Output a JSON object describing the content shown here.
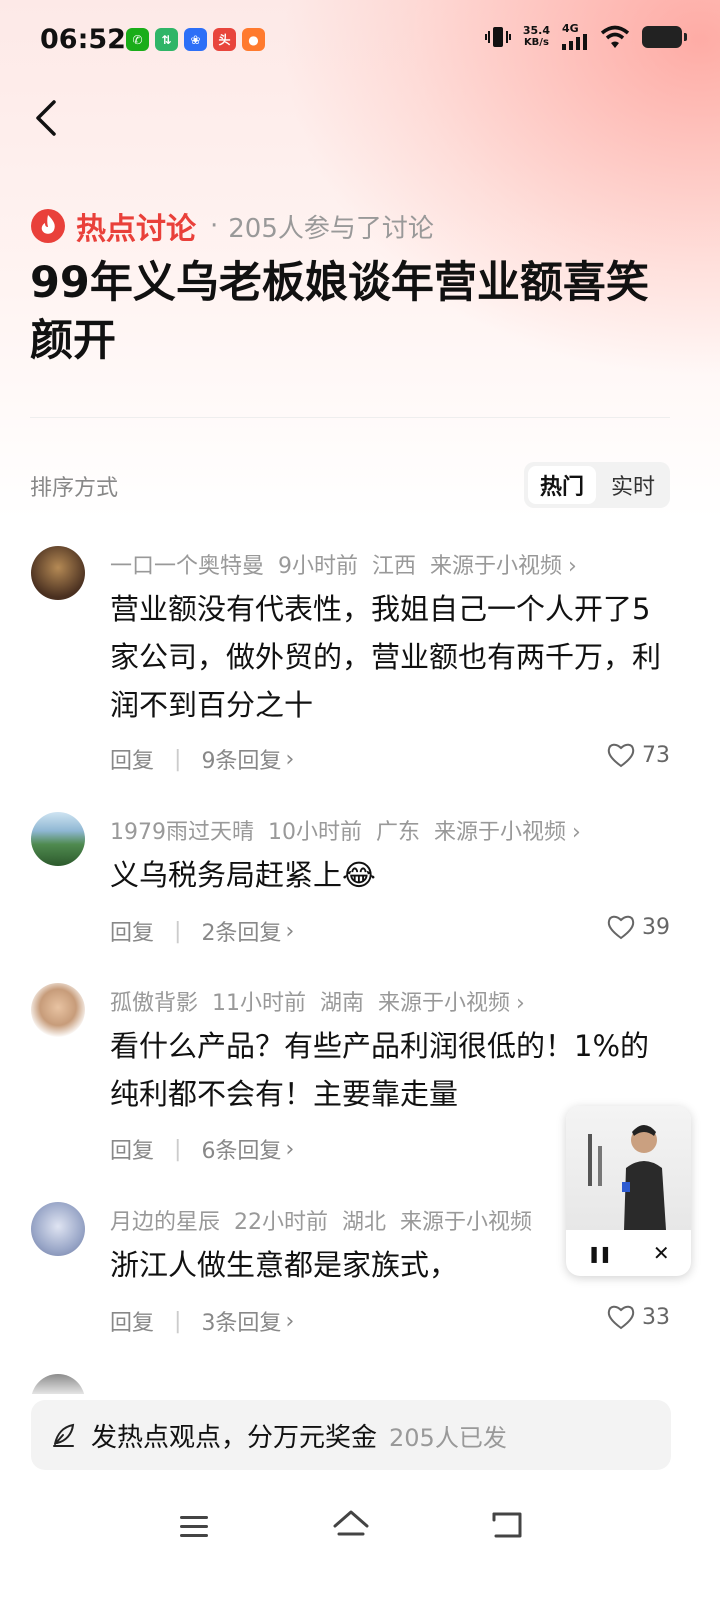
{
  "status_bar": {
    "time": "06:52",
    "net_speed_value": "35.4",
    "net_speed_unit": "KB/s",
    "network": "4G",
    "notification_apps": [
      {
        "icon": "wechat-icon",
        "color": "#1AAD19",
        "glyph": "✆"
      },
      {
        "icon": "app-green-icon",
        "color": "#2fb567",
        "glyph": "⇅"
      },
      {
        "icon": "baidu-icon",
        "color": "#2d6ff7",
        "glyph": "❀"
      },
      {
        "icon": "toutiao-icon",
        "color": "#e8453c",
        "glyph": "头"
      },
      {
        "icon": "app-orange-icon",
        "color": "#ff7a2e",
        "glyph": "●"
      }
    ]
  },
  "topic": {
    "label": "热点讨论",
    "separator": "·",
    "participants": "205人参与了讨论",
    "title": "99年义乌老板娘谈年营业额喜笑颜开"
  },
  "sort": {
    "label": "排序方式",
    "options": [
      "热门",
      "实时"
    ],
    "selected": "热门"
  },
  "comments": [
    {
      "user": "一口一个奥特曼",
      "time": "9小时前",
      "region": "江西",
      "source": "来源于小视频",
      "text": "营业额没有代表性，我姐自己一个人开了5家公司，做外贸的，营业额也有两千万，利润不到百分之十",
      "reply": "回复",
      "replies": "9条回复",
      "likes": "73",
      "avatar_color": "#6b4a2b"
    },
    {
      "user": "1979雨过天晴",
      "time": "10小时前",
      "region": "广东",
      "source": "来源于小视频",
      "text": "义乌税务局赶紧上",
      "emoji": "😂",
      "reply": "回复",
      "replies": "2条回复",
      "likes": "39",
      "avatar_color": "#3f7d4a"
    },
    {
      "user": "孤傲背影",
      "time": "11小时前",
      "region": "湖南",
      "source": "来源于小视频",
      "text": "看什么产品？有些产品利润很低的！1%的纯利都不会有！主要靠走量",
      "reply": "回复",
      "replies": "6条回复",
      "likes": "",
      "avatar_color": "#caa88a"
    },
    {
      "user": "月边的星辰",
      "time": "22小时前",
      "region": "湖北",
      "source": "来源于小视频",
      "text": "浙江人做生意都是家族式，",
      "reply": "回复",
      "replies": "3条回复",
      "likes": "33",
      "avatar_color": "#9aa7c8"
    }
  ],
  "floating_player": {
    "pause_label": "❚❚",
    "close_label": "✕"
  },
  "post_bar": {
    "text": "发热点观点，分万元奖金",
    "count": "205人已发"
  },
  "colors": {
    "accent": "#e9403a",
    "meta": "#999999"
  }
}
